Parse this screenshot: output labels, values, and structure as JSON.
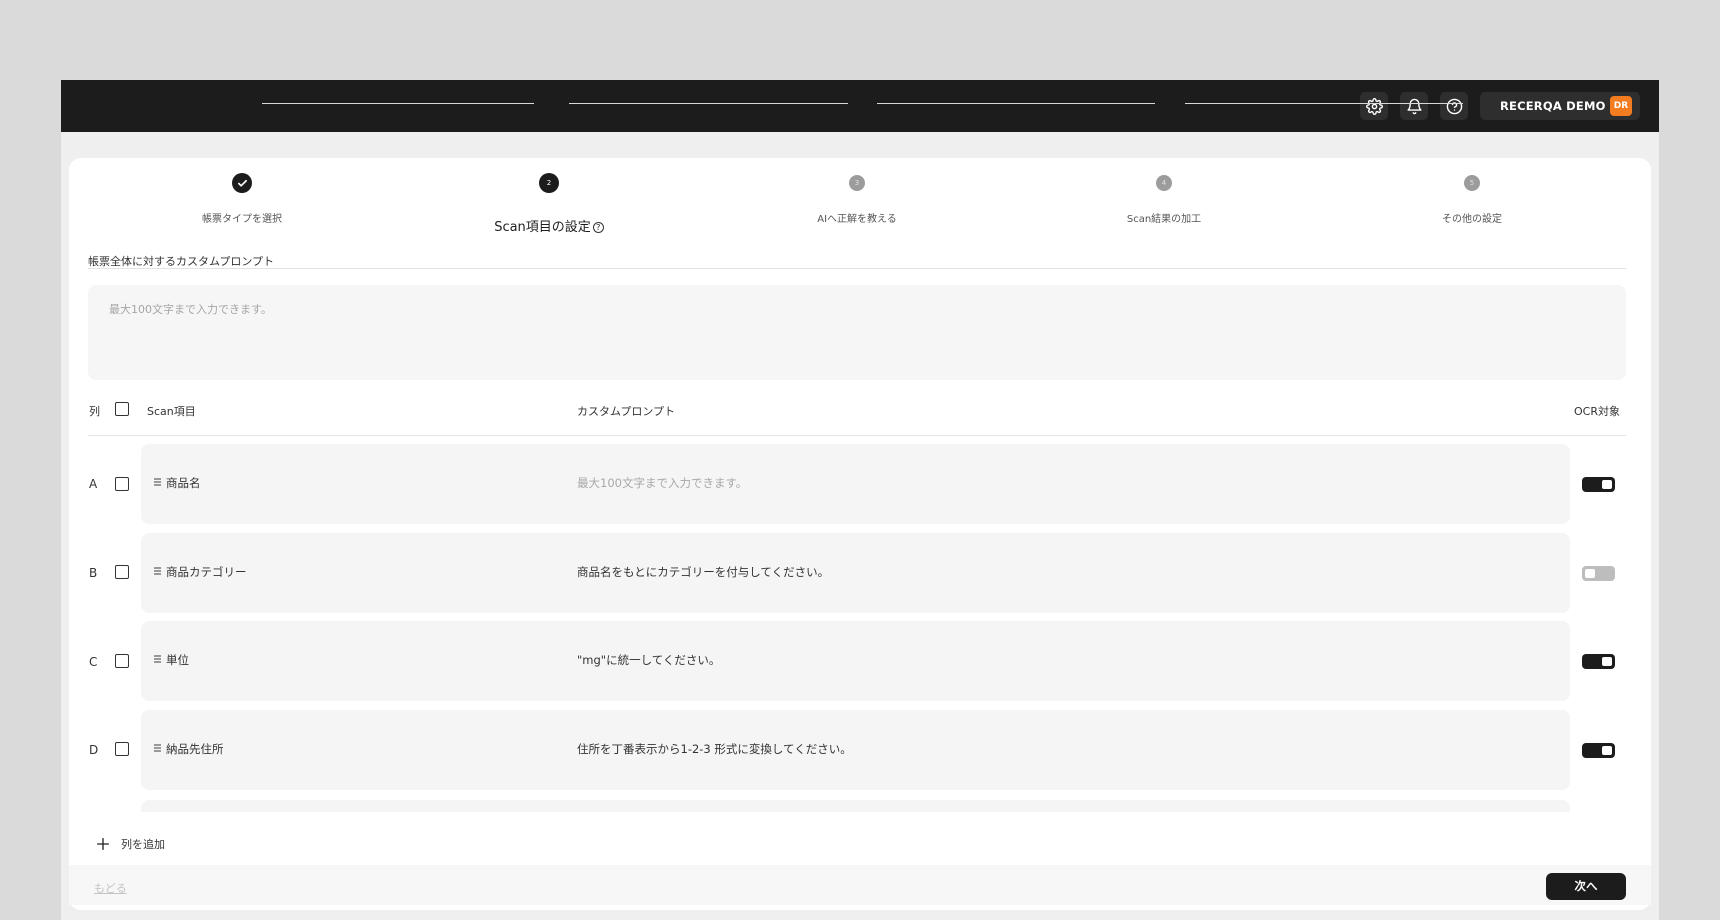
{
  "header": {
    "icons": [
      "gear-icon",
      "bell-icon",
      "help-icon"
    ],
    "account_name": "RECERQA DEMO",
    "avatar_initials": "DR",
    "avatar_color": "#f47c20"
  },
  "stepper": {
    "steps": [
      {
        "number": "1",
        "label": "帳票タイプを選択",
        "state": "done"
      },
      {
        "number": "2",
        "label": "Scan項目の設定",
        "state": "active"
      },
      {
        "number": "3",
        "label": "AIへ正解を教える",
        "state": "todo"
      },
      {
        "number": "4",
        "label": "Scan結果の加工",
        "state": "todo"
      },
      {
        "number": "5",
        "label": "その他の設定",
        "state": "todo"
      }
    ]
  },
  "global_prompt": {
    "label": "帳票全体に対するカスタムプロンプト",
    "placeholder": "最大100文字まで入力できます。",
    "value": ""
  },
  "table": {
    "col_header": "列",
    "item_header": "Scan項目",
    "prompt_header": "カスタムプロンプト",
    "ocr_header": "OCR対象",
    "prompt_placeholder": "最大100文字まで入力できます。",
    "rows": [
      {
        "letter": "A",
        "name": "商品名",
        "prompt": "",
        "ocr": true
      },
      {
        "letter": "B",
        "name": "商品カテゴリー",
        "prompt": "商品名をもとにカテゴリーを付与してください。",
        "ocr": false
      },
      {
        "letter": "C",
        "name": "単位",
        "prompt": "\"mg\"に統一してください。",
        "ocr": true
      },
      {
        "letter": "D",
        "name": "納品先住所",
        "prompt": "住所を丁番表示から1-2-3 形式に変換してください。",
        "ocr": true
      }
    ]
  },
  "actions": {
    "add_column": "列を追加",
    "back": "もどる",
    "next": "次へ"
  },
  "colors": {
    "topbar": "#1c1c1c",
    "accent": "#1c1c1c",
    "toggle_off": "#bdbdbd"
  }
}
